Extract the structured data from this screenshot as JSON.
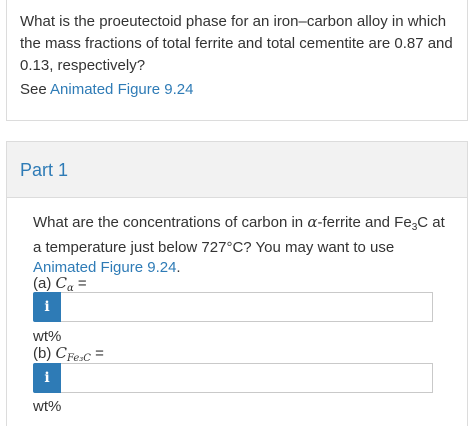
{
  "question": {
    "text": "What is the proeutectoid phase for an iron–carbon alloy in which the mass fractions of total ferrite and total cementite are 0.87 and 0.13, respectively?",
    "see_prefix": "See ",
    "see_link": "Animated Figure 9.24"
  },
  "part": {
    "title": "Part 1",
    "prompt_before": "What are the concentrations of carbon in ",
    "alpha_symbol": "α",
    "prompt_mid1": "-ferrite and Fe",
    "fe3c_sub": "3",
    "prompt_mid2": "C at a temperature just below 727°C? You may want to use ",
    "prompt_link": "Animated Figure 9.24",
    "prompt_end": ".",
    "answers": [
      {
        "label_prefix": "(a) ",
        "symbol": "C",
        "subscript": "α",
        "equals": " =",
        "info_icon": "i",
        "value": "",
        "unit": "wt%"
      },
      {
        "label_prefix": "(b) ",
        "symbol": "C",
        "subscript": "Fe₃C",
        "equals": " =",
        "info_icon": "i",
        "value": "",
        "unit": "wt%"
      }
    ]
  },
  "colors": {
    "accent": "#2e7bb6",
    "header_bg": "#f2f2f2",
    "border": "#dcdcdc"
  }
}
